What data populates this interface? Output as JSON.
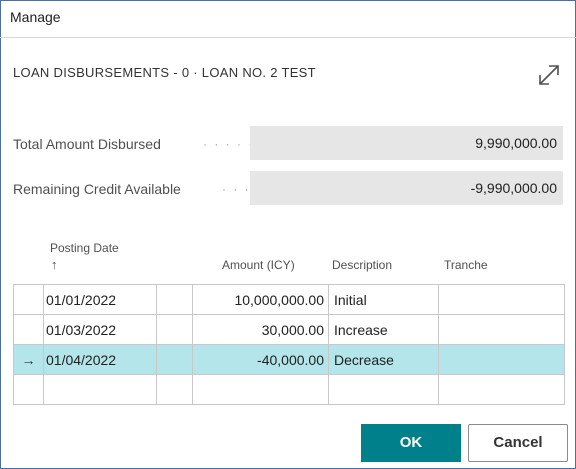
{
  "window": {
    "title": "Manage"
  },
  "page": {
    "heading": "LOAN DISBURSEMENTS - 0 · LOAN NO. 2 TEST",
    "expand_icon": "expand-arrows-icon"
  },
  "fields": {
    "total_label": "Total Amount Disbursed",
    "total_value": "9,990,000.00",
    "remaining_label": "Remaining Credit Available",
    "remaining_value": "-9,990,000.00"
  },
  "table": {
    "columns": {
      "posting_date": "Posting Date",
      "sort_indicator": "↑",
      "amount": "Amount (ICY)",
      "description": "Description",
      "tranche": "Tranche"
    },
    "rows": [
      {
        "marker": "",
        "posting_date": "01/01/2022",
        "amount": "10,000,000.00",
        "description": "Initial",
        "tranche": ""
      },
      {
        "marker": "",
        "posting_date": "01/03/2022",
        "amount": "30,000.00",
        "description": "Increase",
        "tranche": ""
      },
      {
        "marker": "→",
        "posting_date": "01/04/2022",
        "amount": "-40,000.00",
        "description": "Decrease",
        "tranche": "",
        "selected": true
      }
    ]
  },
  "buttons": {
    "ok": "OK",
    "cancel": "Cancel"
  },
  "colors": {
    "accent": "#00808a",
    "selected_row": "#b3e5ea",
    "field_bg": "#e6e6e6"
  }
}
